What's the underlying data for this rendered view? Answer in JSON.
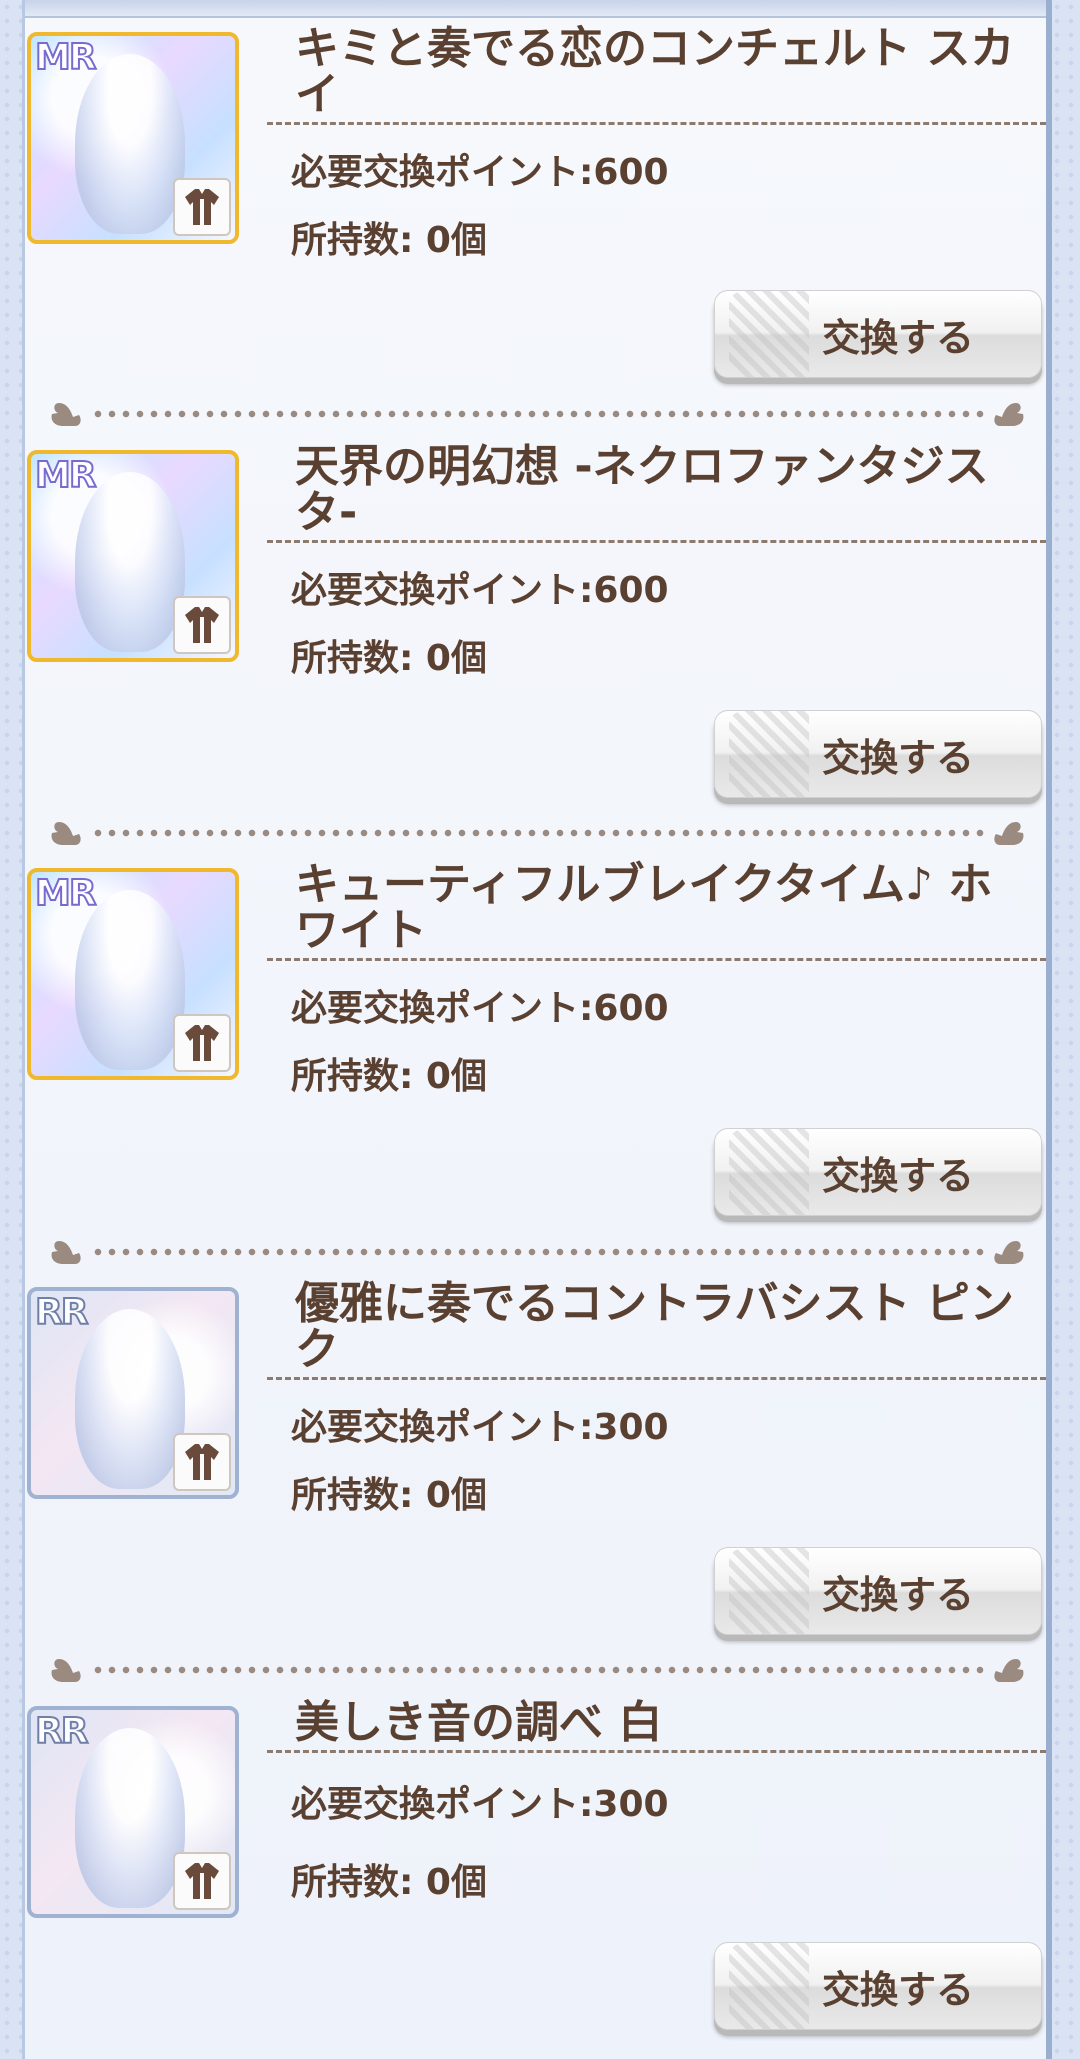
{
  "items": [
    {
      "rarity": "MR",
      "title": "キミと奏でる恋のコンチェルト スカイ",
      "points": "必要交換ポイント:600",
      "owned": "所持数: 0個",
      "button": "交換する"
    },
    {
      "rarity": "MR",
      "title": "天界の明幻想 -ネクロファンタジスタ-",
      "points": "必要交換ポイント:600",
      "owned": "所持数: 0個",
      "button": "交換する"
    },
    {
      "rarity": "MR",
      "title": "キューティフルブレイクタイム♪ ホワイト",
      "points": "必要交換ポイント:600",
      "owned": "所持数: 0個",
      "button": "交換する"
    },
    {
      "rarity": "RR",
      "title": "優雅に奏でるコントラバシスト ピンク",
      "points": "必要交換ポイント:300",
      "owned": "所持数: 0個",
      "button": "交換する"
    },
    {
      "rarity": "RR",
      "title": "美しき音の調べ 白",
      "points": "必要交換ポイント:300",
      "owned": "所持数: 0個",
      "button": "交換する"
    }
  ],
  "icons": {
    "item_type": "dress-icon",
    "separator": "duck-icon"
  },
  "colors": {
    "text": "#5a4030",
    "mr_border": "#f0b82c",
    "rr_border": "#9fb2d2"
  }
}
